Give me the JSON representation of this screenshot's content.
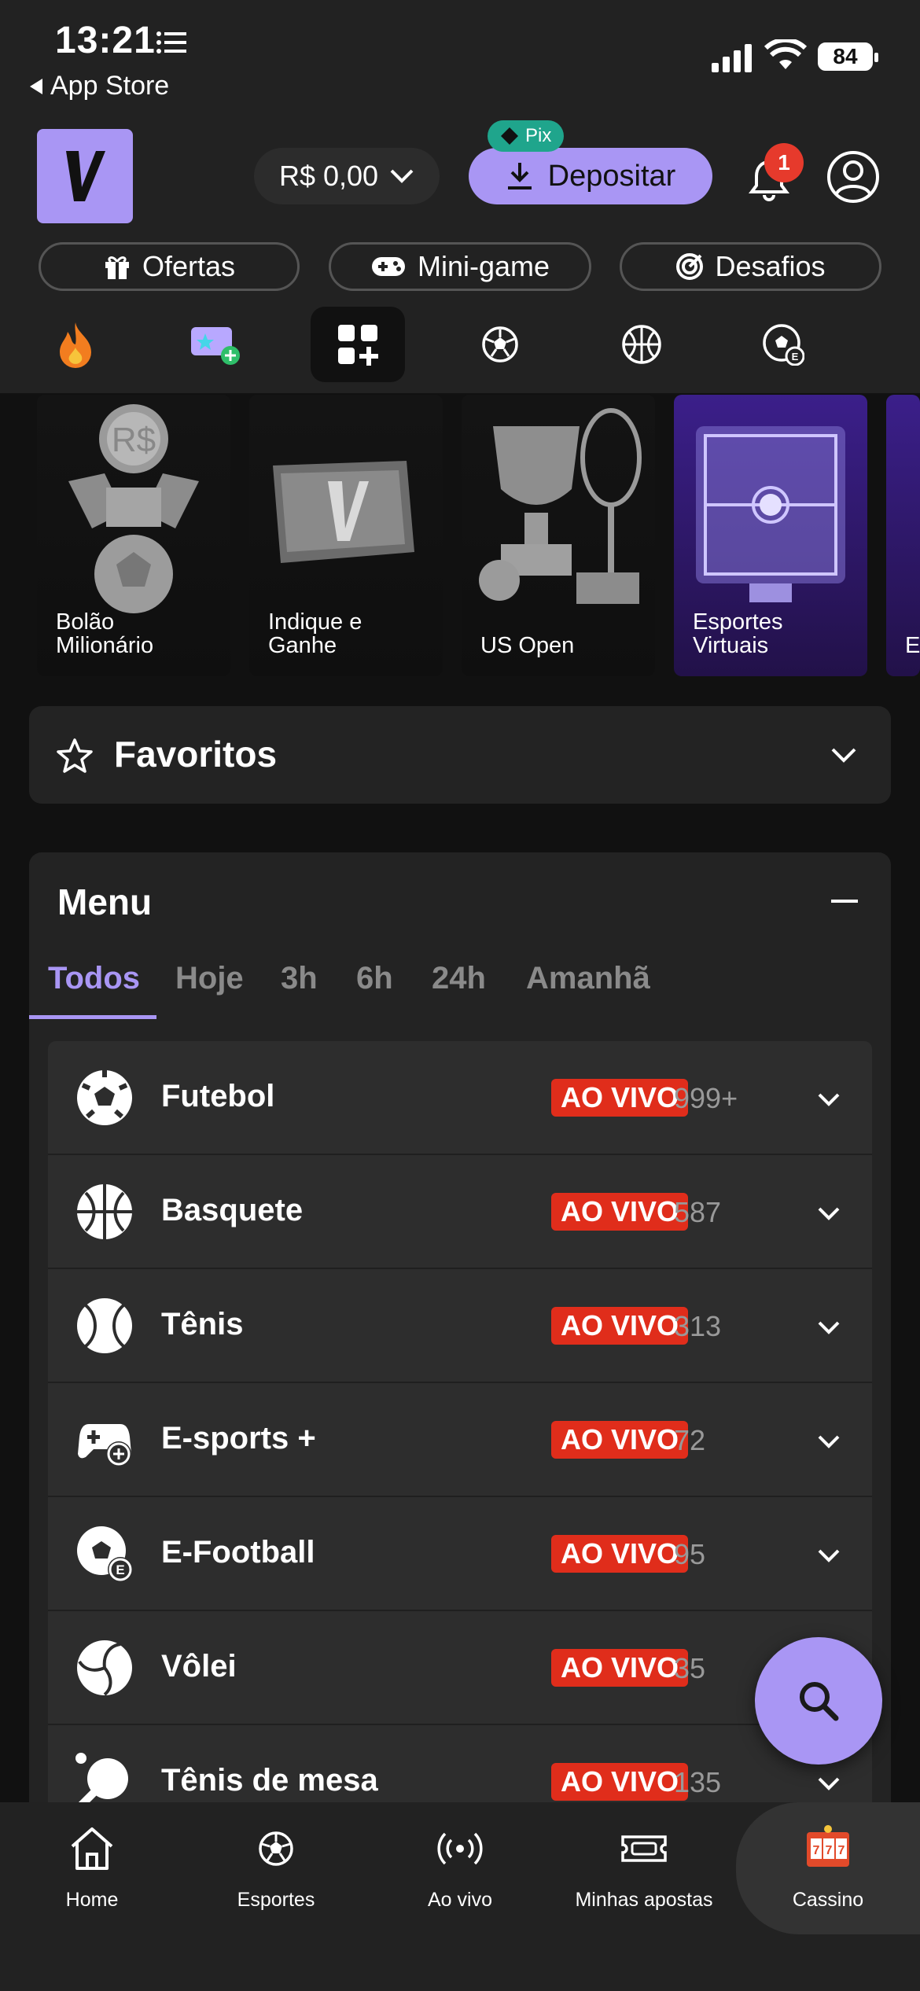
{
  "status_bar": {
    "time": "13:21",
    "back_label": "App Store",
    "battery": "84"
  },
  "header": {
    "balance": "R$ 0,00",
    "pix_badge": "Pix",
    "deposit_label": "Depositar",
    "notification_count": "1"
  },
  "quick_links": [
    {
      "label": "Ofertas",
      "icon": "gift-icon"
    },
    {
      "label": "Mini-game",
      "icon": "gamepad-icon"
    },
    {
      "label": "Desafios",
      "icon": "target-icon"
    }
  ],
  "categories": [
    "fire-icon",
    "ticket-star-icon",
    "grid-plus-icon",
    "soccer-ball-icon",
    "basketball-icon",
    "e-football-icon"
  ],
  "promos": [
    {
      "label_line1": "Bolão",
      "label_line2": "Milionário"
    },
    {
      "label_line1": "Indique e",
      "label_line2": "Ganhe"
    },
    {
      "label_line1": "US Open",
      "label_line2": ""
    },
    {
      "label_line1": "Esportes",
      "label_line2": "Virtuais"
    },
    {
      "label_line1": "E",
      "label_line2": ""
    }
  ],
  "favorites": {
    "title": "Favoritos"
  },
  "menu": {
    "title": "Menu",
    "tabs": [
      "Todos",
      "Hoje",
      "3h",
      "6h",
      "24h",
      "Amanhã"
    ],
    "active_tab": "Todos",
    "live_label": "AO VIVO",
    "sports": [
      {
        "name": "Futebol",
        "count": "999+",
        "icon": "soccer-ball-icon"
      },
      {
        "name": "Basquete",
        "count": "587",
        "icon": "basketball-icon"
      },
      {
        "name": "Tênis",
        "count": "313",
        "icon": "tennis-ball-icon"
      },
      {
        "name": "E-sports +",
        "count": "72",
        "icon": "gamepad-plus-icon"
      },
      {
        "name": "E-Football",
        "count": "95",
        "icon": "e-football-icon"
      },
      {
        "name": "Vôlei",
        "count": "35",
        "icon": "volleyball-icon"
      },
      {
        "name": "Tênis de mesa",
        "count": "135",
        "icon": "table-tennis-icon"
      }
    ]
  },
  "bottom_nav": [
    {
      "label": "Home",
      "icon": "home-icon"
    },
    {
      "label": "Esportes",
      "icon": "soccer-ball-icon"
    },
    {
      "label": "Ao vivo",
      "icon": "live-broadcast-icon"
    },
    {
      "label": "Minhas apostas",
      "icon": "ticket-icon"
    },
    {
      "label": "Cassino",
      "icon": "slot-machine-icon"
    }
  ],
  "colors": {
    "accent": "#a996f4",
    "live": "#e02d1b",
    "pix": "#1fa58c",
    "card": "#232323",
    "row": "#2d2d2d"
  }
}
